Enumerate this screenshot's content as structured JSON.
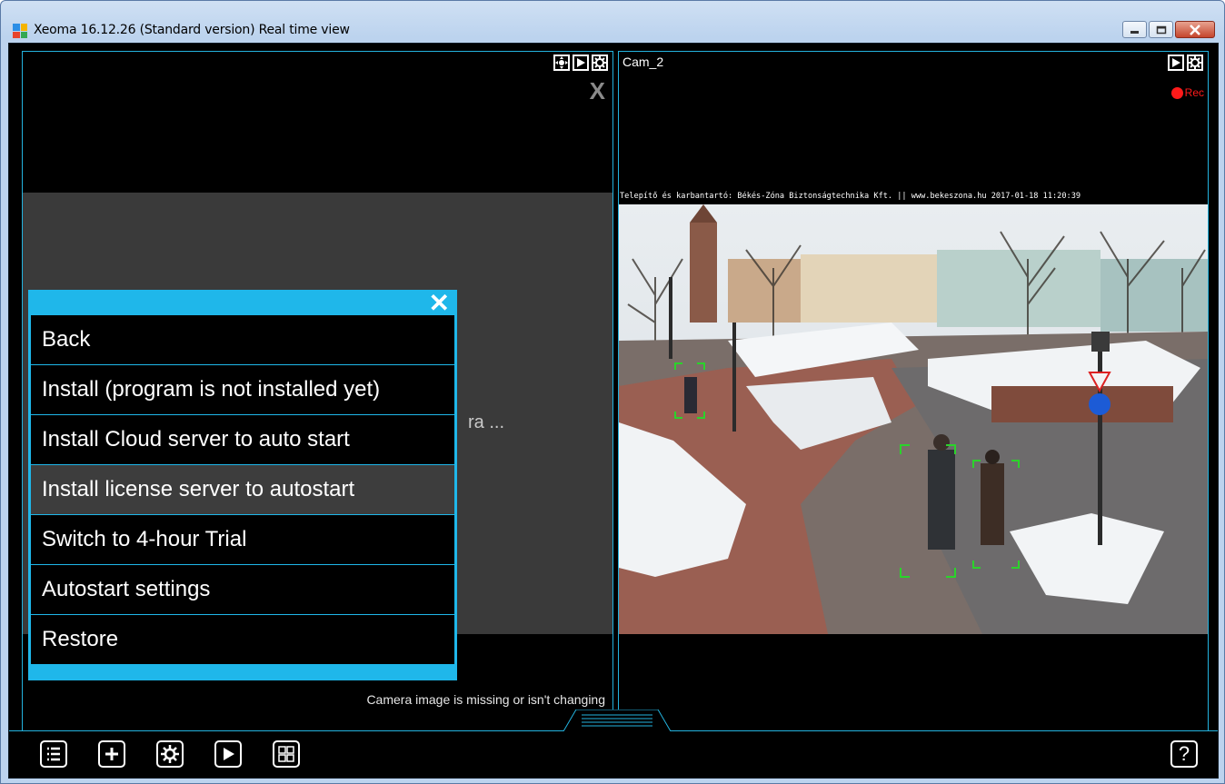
{
  "window": {
    "title": "Xeoma 16.12.26 (Standard version) Real time view",
    "minimize_label": "▁",
    "maximize_label": "▢",
    "close_label": "✕"
  },
  "left_pane": {
    "connecting_text": "ra ...",
    "close_symbol": "X",
    "status_text": "Camera image is missing or isn't changing"
  },
  "menu": {
    "close_symbol": "✕",
    "items": [
      {
        "label": "Back"
      },
      {
        "label": "Install (program is not installed yet)"
      },
      {
        "label": "Install Cloud server to auto start"
      },
      {
        "label": "Install license server to autostart"
      },
      {
        "label": "Switch to 4-hour Trial"
      },
      {
        "label": "Autostart settings"
      },
      {
        "label": "Restore"
      }
    ]
  },
  "right_pane": {
    "camera_name": "Cam_2",
    "rec_label": "Rec",
    "overlay_text": "Telepítő és karbantartó: Békés-Zóna Biztonságtechnika Kft. || www.bekeszona.hu 2017-01-18 11:20:39"
  },
  "toolbar": {
    "help_label": "?"
  },
  "colors": {
    "accent": "#1fb7ea",
    "pane_border": "#23b3df",
    "rec": "#ff1a1a"
  }
}
